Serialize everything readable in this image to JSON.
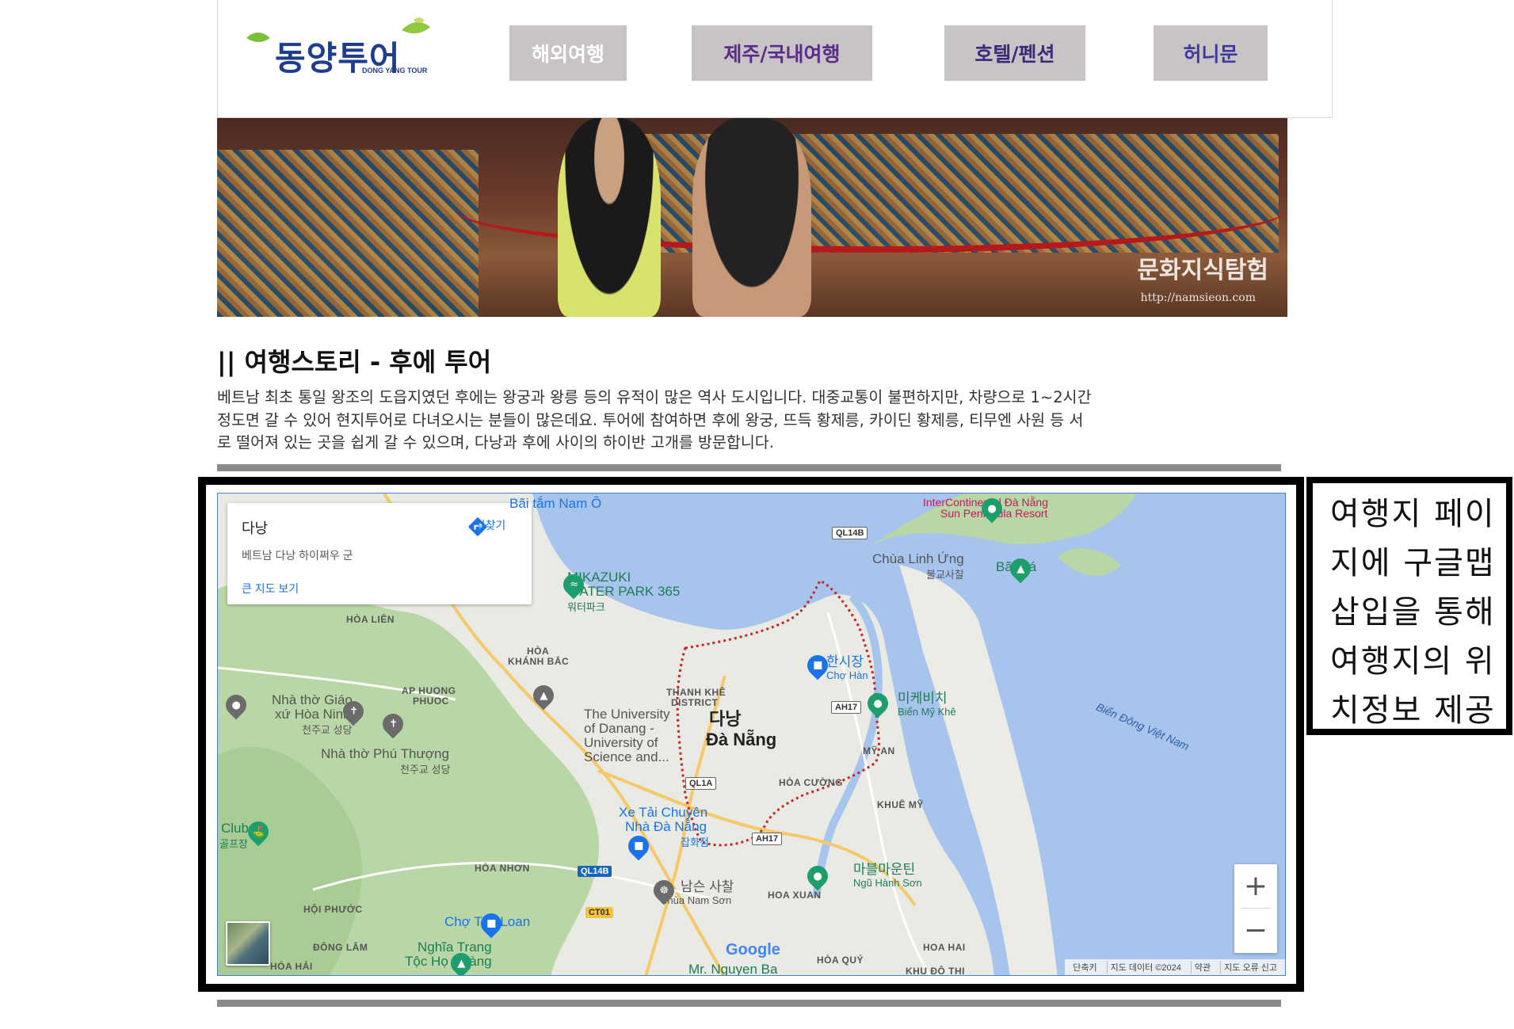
{
  "brand": {
    "name": "동양투어",
    "subtitle": "DONG YANG TOUR"
  },
  "nav": [
    {
      "label": "해외여행"
    },
    {
      "label": "제주/국내여행"
    },
    {
      "label": "호텔/펜션"
    },
    {
      "label": "허니문"
    }
  ],
  "hero": {
    "watermark": "문화지식탐험",
    "watermark_url": "http://namsieon.com"
  },
  "story": {
    "title": "|| 여행스토리 - 후에 투어",
    "lines": [
      "베트남 최초 통일 왕조의 도읍지였던 후에는 왕궁과 왕릉 등의 유적이 많은 역사 도시입니다. 대중교통이 불편하지만, 차량으로 1~2시간",
      "정도면 갈 수 있어 현지투어로 다녀오시는 분들이 많은데요. 투어에 참여하면 후에 왕궁, 뜨득 황제릉, 카이딘 황제릉, 티무엔 사원 등 서",
      "로 떨어져 있는 곳을 쉽게 갈 수 있으며, 다낭과 후에 사이의 하이반 고개를 방문합니다."
    ]
  },
  "map": {
    "place_name": "다낭",
    "address": "베트남 다낭 하이쩌우 군",
    "directions_label": "길찾기",
    "larger_map_label": "큰 지도 보기",
    "city_label_ko": "다낭",
    "city_label_vi": "Đà Nẵng",
    "zoom_in": "+",
    "zoom_out": "−",
    "google_logo": "Google",
    "footer": [
      "단축키",
      "지도 데이터 ©2024",
      "약관",
      "지도 오류 신고"
    ],
    "labels": {
      "bai_tam": "Bãi tắm Nam Ô",
      "intercontinental_1": "InterContinental Đà Nẵng",
      "intercontinental_2": "Sun Peninsula Resort",
      "chua_linh_ung": "Chùa Linh Ứng",
      "chua_linh_ung_ko": "불교사찰",
      "bai_da": "Bãi Đá",
      "mikazuki_1": "MIKAZUKI",
      "mikazuki_2": "WATER PARK 365",
      "mikazuki_ko": "워터파크",
      "hoa_lien": "HÒA LIÊN",
      "hoa_khanh_bac_1": "HÒA",
      "hoa_khanh_bac_2": "KHÁNH BẮC",
      "ap_huong_phuoc_1": "AP HUONG",
      "ap_huong_phuoc_2": "PHUOC",
      "thanh_khe_1": "THANH KHÊ",
      "thanh_khe_2": "DISTRICT",
      "han_market_ko": "한시장",
      "han_market_vi": "Chợ Hàn",
      "my_khe_ko": "미케비치",
      "my_khe_vi": "Biển Mỹ Khê",
      "sea": "Biển Đông Việt Nam",
      "hoa_ninh_1": "Nhà thờ Giáo",
      "hoa_ninh_2": "xứ Hòa Ninh",
      "hoa_ninh_ko": "천주교 성당",
      "phu_thuong": "Nhà thờ Phú Thượng",
      "phu_thuong_ko": "천주교 성당",
      "university_1": "The University",
      "university_2": "of Danang -",
      "university_3": "University of",
      "university_4": "Science and...",
      "my_an": "MỸ AN",
      "hoa_cuong": "HÒA CƯỜNG",
      "khue_my": "KHUÊ MỸ",
      "club": "Club",
      "club_ko": "골프장",
      "xe_tai_1": "Xe Tải Chuyên",
      "xe_tai_2": "Nhà Đà Nẵng",
      "xe_tai_ko": "잡화점",
      "hoa_nhon": "HÒA NHƠN",
      "marble_ko": "마블마운틴",
      "marble_vi": "Ngũ Hành Sơn",
      "nam_son_ko": "남슨 사찰",
      "nam_son_vi": "Chùa Nam Sơn",
      "hoa_xuan": "HOA XUAN",
      "hoi_phuoc": "HỘI PHƯỚC",
      "cho_tuy_loan": "Chợ Túy Loan",
      "dong_lam": "ĐÔNG LÂM",
      "nghia_trang_1": "Nghĩa Trang",
      "nghia_trang_2": "Tộc Họ Hoàng",
      "hoa_hai": "HÒA HẢI",
      "hoa_hai_2": "HOA HAI",
      "hoa_quy": "HÒA QUÝ",
      "mr_nguyen": "Mr. Nguyen Ba",
      "khu_do_thi": "KHU ĐÔ THỊ"
    },
    "roads": [
      "QL14B",
      "AH17",
      "QL1A",
      "AH17",
      "QL14B",
      "CT01"
    ]
  },
  "annotation": {
    "lines": [
      "여행지 페이",
      "지에 구글맵",
      "삽입을 통해",
      "여행지의 위",
      "치정보 제공"
    ]
  },
  "colors": {
    "nav_bg": "#c8c3c4",
    "map_water": "#a7c4ed",
    "divider": "#8a8a8a",
    "link": "#1a73e8"
  }
}
